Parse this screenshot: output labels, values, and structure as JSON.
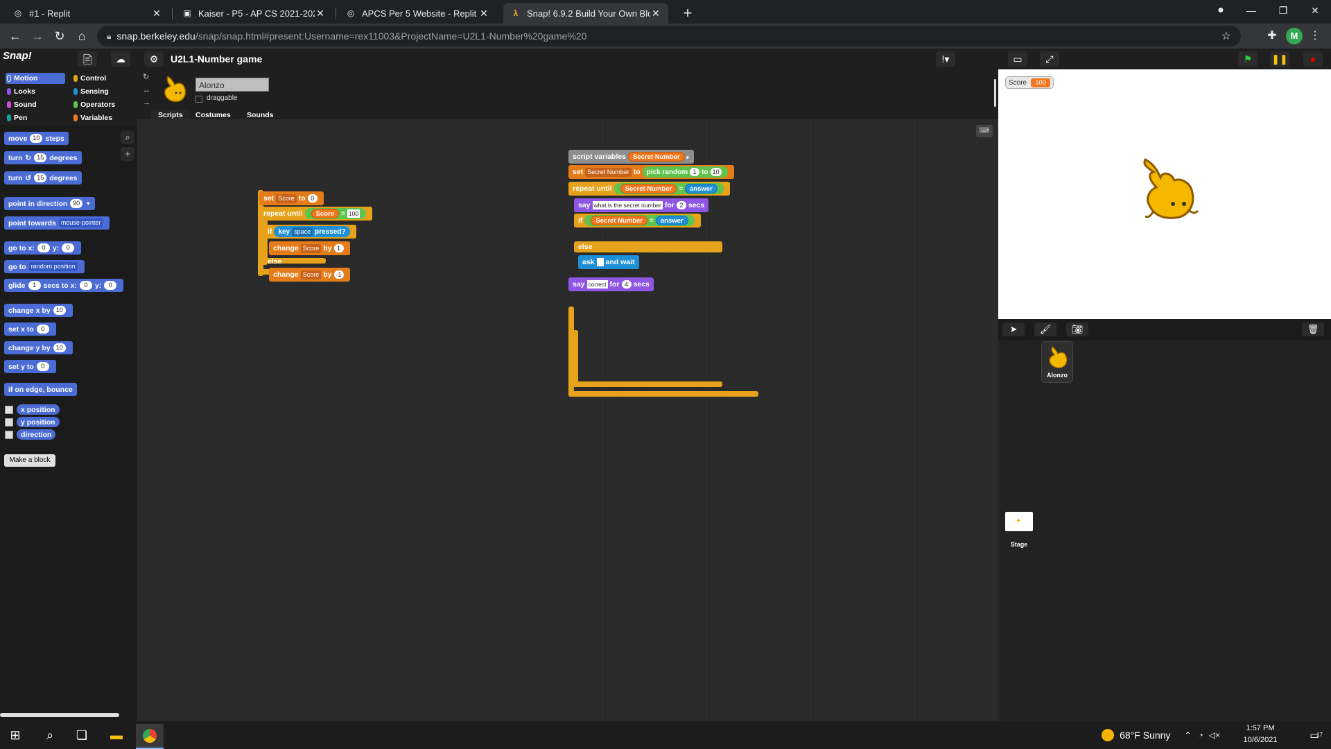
{
  "tabs": [
    {
      "title": "#1 - Replit"
    },
    {
      "title": "Kaiser - P5 - AP CS 2021-2022"
    },
    {
      "title": "APCS Per 5 Website - Replit"
    },
    {
      "title": "Snap! 6.9.2 Build Your Own Block"
    }
  ],
  "address": {
    "host": "snap.berkeley.edu",
    "path": "/snap/snap.html#present:Username=rex11003&ProjectName=U2L1-Number%20game%20"
  },
  "profile_initial": "M",
  "snap": {
    "logo": "Snap!",
    "project_title": "U2L1-Number game",
    "categories": [
      {
        "label": "Motion",
        "color": "#4a6cd4"
      },
      {
        "label": "Control",
        "color": "#e5a21a"
      },
      {
        "label": "Looks",
        "color": "#8f56e3"
      },
      {
        "label": "Sensing",
        "color": "#1f8fd8"
      },
      {
        "label": "Sound",
        "color": "#cf4ad9"
      },
      {
        "label": "Operators",
        "color": "#5ec44b"
      },
      {
        "label": "Pen",
        "color": "#0fa59b"
      },
      {
        "label": "Variables",
        "color": "#f3761d"
      }
    ],
    "palette": {
      "move": {
        "a": "move",
        "v": "10",
        "b": "steps"
      },
      "turn_cw": {
        "a": "turn",
        "v": "15",
        "b": "degrees"
      },
      "turn_ccw": {
        "a": "turn",
        "v": "15",
        "b": "degrees"
      },
      "point_dir": {
        "a": "point in direction",
        "v": "90"
      },
      "point_towards": {
        "a": "point towards",
        "v": "mouse-pointer"
      },
      "goto_xy": {
        "a": "go to x:",
        "x": "0",
        "b": "y:",
        "y": "0"
      },
      "goto": {
        "a": "go to",
        "v": "random position"
      },
      "glide": {
        "a": "glide",
        "s": "1",
        "b": "secs to x:",
        "x": "0",
        "c": "y:",
        "y": "0"
      },
      "change_x": {
        "a": "change x by",
        "v": "10"
      },
      "set_x": {
        "a": "set x to",
        "v": "0"
      },
      "change_y": {
        "a": "change y by",
        "v": "10"
      },
      "set_y": {
        "a": "set y to",
        "v": "0"
      },
      "bounce": "if on edge, bounce",
      "reporters": [
        "x position",
        "y position",
        "direction"
      ],
      "make_block": "Make a block"
    },
    "sprite": {
      "name": "Alonzo",
      "draggable_label": "draggable",
      "tabs": [
        "Scripts",
        "Costumes",
        "Sounds"
      ]
    },
    "script1": {
      "set": "set",
      "set_var": "Score",
      "set_to": "to",
      "set_val": "0",
      "repeat": "repeat until",
      "rep_var": "Score",
      "rep_op": "=",
      "rep_val": "100",
      "if": "if",
      "key": "key",
      "key_val": "space",
      "pressed": "pressed?",
      "change": "change",
      "ch_var": "Score",
      "by": "by",
      "ch_val": "1",
      "else": "else",
      "change2": "change",
      "ch2_var": "Score",
      "by2": "by",
      "ch2_val": "-1"
    },
    "script2": {
      "script_vars": "script variables",
      "sv_var": "Secret Number",
      "set": "set",
      "set_var": "Secret Number",
      "to": "to",
      "pick": "pick random",
      "p1": "1",
      "pto": "to",
      "p2": "10",
      "repeat": "repeat until",
      "r_var": "Secret Number",
      "r_op": "=",
      "r_ans": "answer",
      "say": "say",
      "say_txt": "what is the secret number",
      "for": "for",
      "say_n": "2",
      "secs": "secs",
      "if": "if",
      "i_var": "Secret Number",
      "i_op": "=",
      "i_ans": "answer",
      "else": "else",
      "ask": "ask",
      "and_wait": "and wait",
      "say2": "say",
      "say2_txt": "correct",
      "for2": "for",
      "say2_n": "4",
      "secs2": "secs"
    },
    "stage": {
      "watcher_label": "Score",
      "watcher_value": "100"
    },
    "corral": {
      "sprite_label": "Alonzo",
      "stage_label": "Stage"
    }
  },
  "taskbar": {
    "weather": "68°F  Sunny",
    "time": "1:57 PM",
    "date": "10/6/2021",
    "notif": "17"
  }
}
